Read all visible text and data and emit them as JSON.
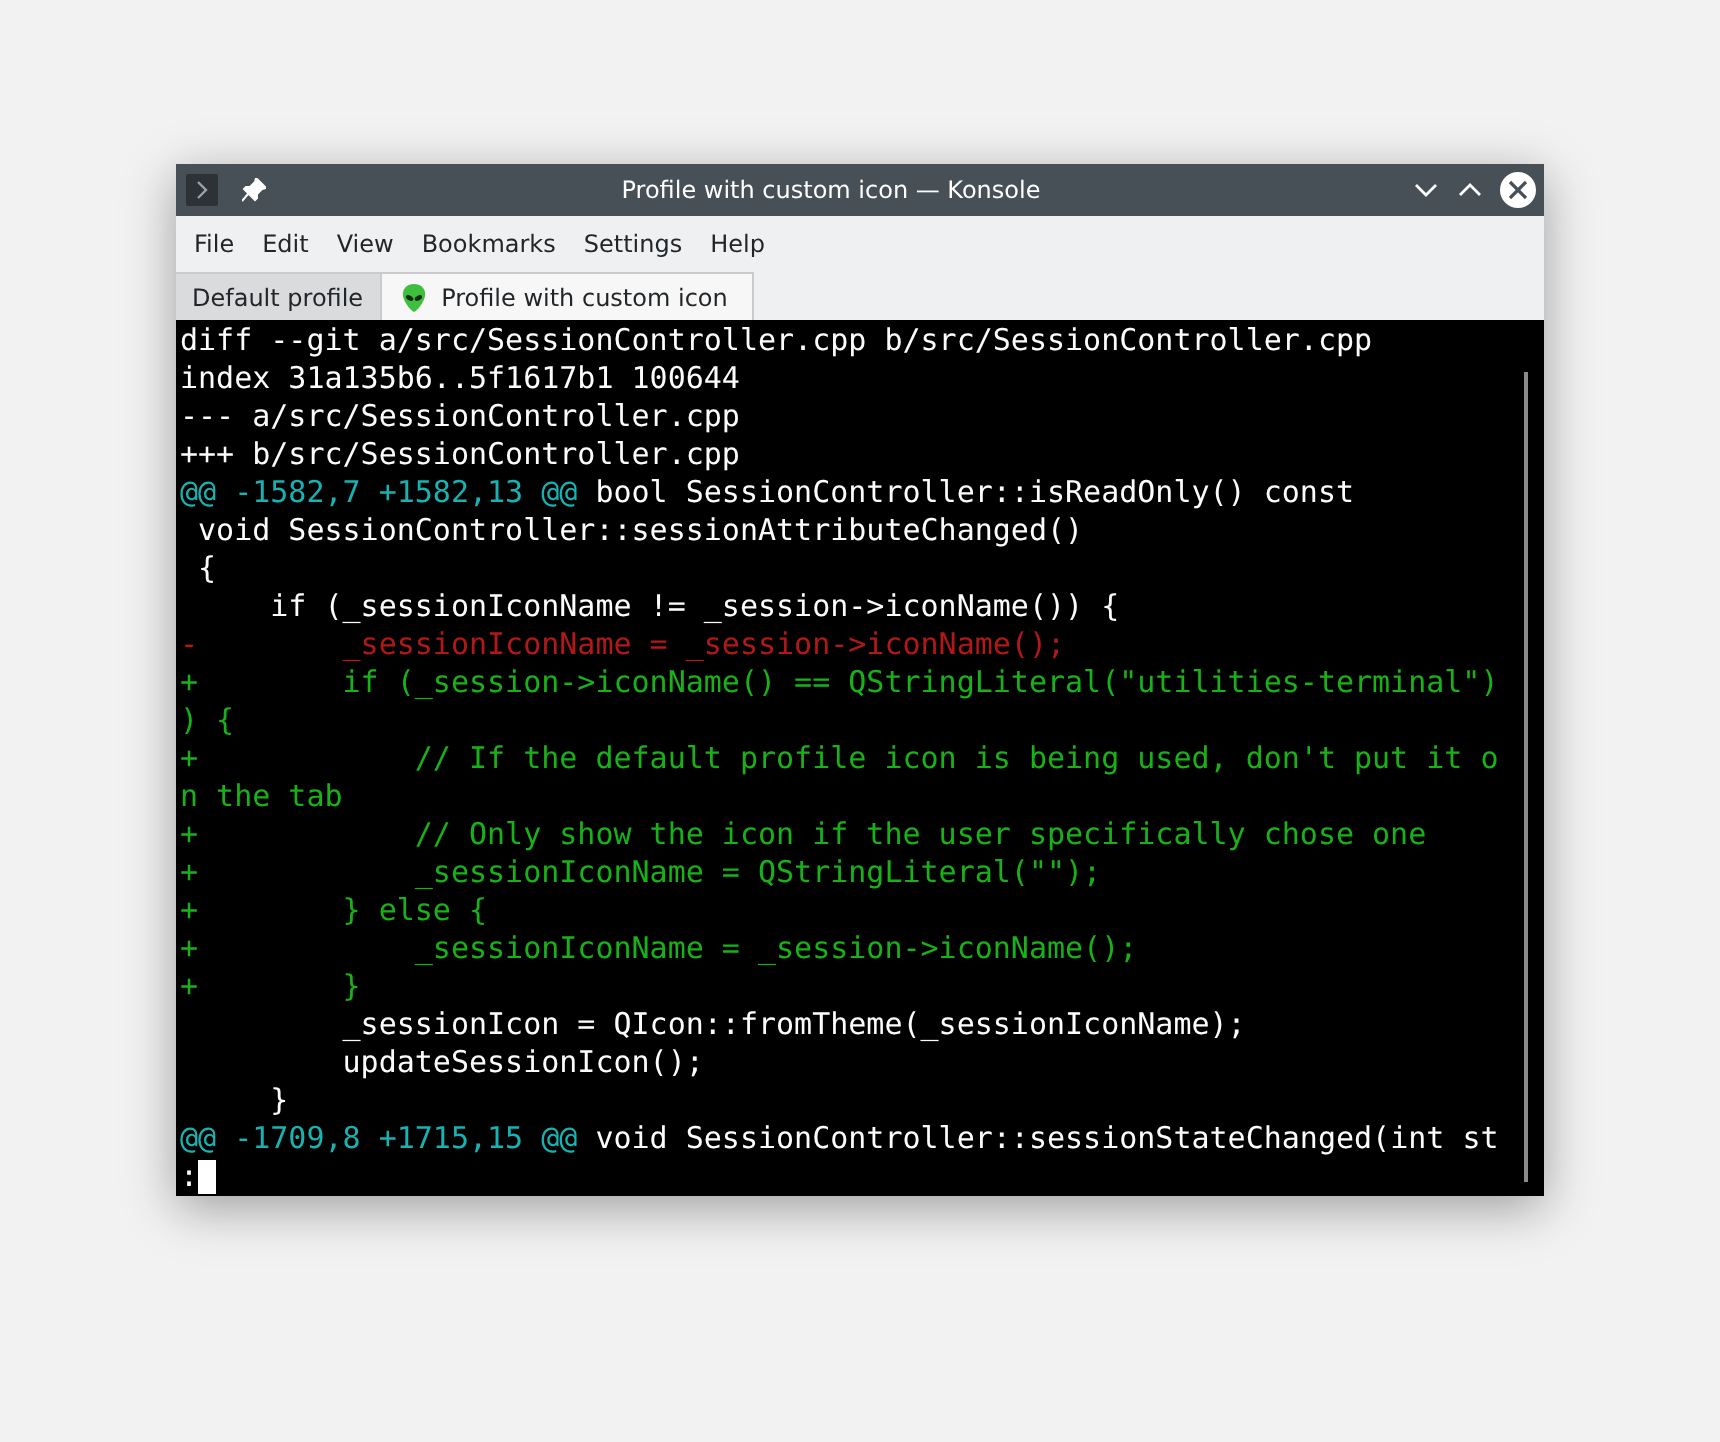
{
  "window": {
    "title": "Profile with custom icon — Konsole"
  },
  "menu": [
    "File",
    "Edit",
    "View",
    "Bookmarks",
    "Settings",
    "Help"
  ],
  "tabs": [
    {
      "label": "Default profile",
      "selected": false,
      "custom_icon": false
    },
    {
      "label": "Profile with custom icon",
      "selected": true,
      "custom_icon": true
    }
  ],
  "terminal": {
    "lines": [
      {
        "kind": "header",
        "text": "diff --git a/src/SessionController.cpp b/src/SessionController.cpp"
      },
      {
        "kind": "header",
        "text": "index 31a135b6..5f1617b1 100644"
      },
      {
        "kind": "header",
        "text": "--- a/src/SessionController.cpp"
      },
      {
        "kind": "header",
        "text": "+++ b/src/SessionController.cpp"
      },
      {
        "kind": "hunk",
        "range": "@@ -1582,7 +1582,13 @@",
        "text": " bool SessionController::isReadOnly() const"
      },
      {
        "kind": "context",
        "text": " void SessionController::sessionAttributeChanged()"
      },
      {
        "kind": "context",
        "text": " {"
      },
      {
        "kind": "context",
        "text": "     if (_sessionIconName != _session->iconName()) {"
      },
      {
        "kind": "removed",
        "text": "-        _sessionIconName = _session->iconName();"
      },
      {
        "kind": "added",
        "text": "+        if (_session->iconName() == QStringLiteral(\"utilities-terminal\")"
      },
      {
        "kind": "added",
        "text": ") {"
      },
      {
        "kind": "added",
        "text": "+            // If the default profile icon is being used, don't put it o"
      },
      {
        "kind": "added",
        "text": "n the tab"
      },
      {
        "kind": "added",
        "text": "+            // Only show the icon if the user specifically chose one"
      },
      {
        "kind": "added",
        "text": "+            _sessionIconName = QStringLiteral(\"\");"
      },
      {
        "kind": "added",
        "text": "+        } else {"
      },
      {
        "kind": "added",
        "text": "+            _sessionIconName = _session->iconName();"
      },
      {
        "kind": "added",
        "text": "+        }"
      },
      {
        "kind": "context",
        "text": "         _sessionIcon = QIcon::fromTheme(_sessionIconName);"
      },
      {
        "kind": "context",
        "text": "         updateSessionIcon();"
      },
      {
        "kind": "context",
        "text": "     }"
      },
      {
        "kind": "hunk",
        "range": "@@ -1709,8 +1715,15 @@",
        "text": " void SessionController::sessionStateChanged(int st"
      },
      {
        "kind": "prompt",
        "text": ":"
      }
    ]
  }
}
